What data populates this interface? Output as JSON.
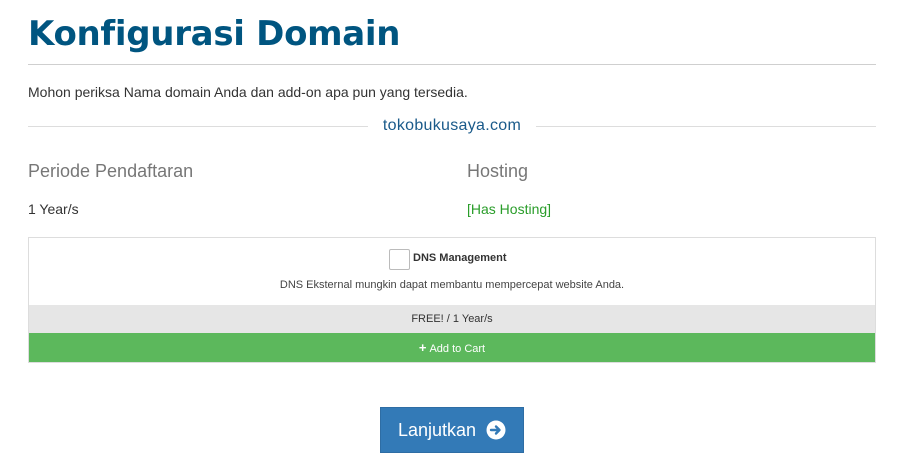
{
  "page": {
    "title": "Konfigurasi Domain",
    "intro": "Mohon periksa Nama domain Anda dan add-on apa pun yang tersedia."
  },
  "domain": {
    "name": "tokobukusaya.com"
  },
  "registration": {
    "heading": "Periode Pendaftaran",
    "value": "1 Year/s"
  },
  "hosting": {
    "heading": "Hosting",
    "value": "[Has Hosting]",
    "value_color": "#2a9d2a"
  },
  "addon": {
    "name": "DNS Management",
    "description": "DNS Eksternal mungkin dapat membantu mempercepat website Anda.",
    "price": "FREE! / 1 Year/s",
    "add_to_cart_label": "Add to Cart",
    "checked": false
  },
  "actions": {
    "continue_label": "Lanjutkan"
  },
  "colors": {
    "title": "#005580",
    "accent_button": "#337ab7",
    "add_to_cart": "#5cb85c"
  },
  "icons": {
    "add_to_cart": "plus-icon",
    "continue": "arrow-circle-right-icon"
  }
}
